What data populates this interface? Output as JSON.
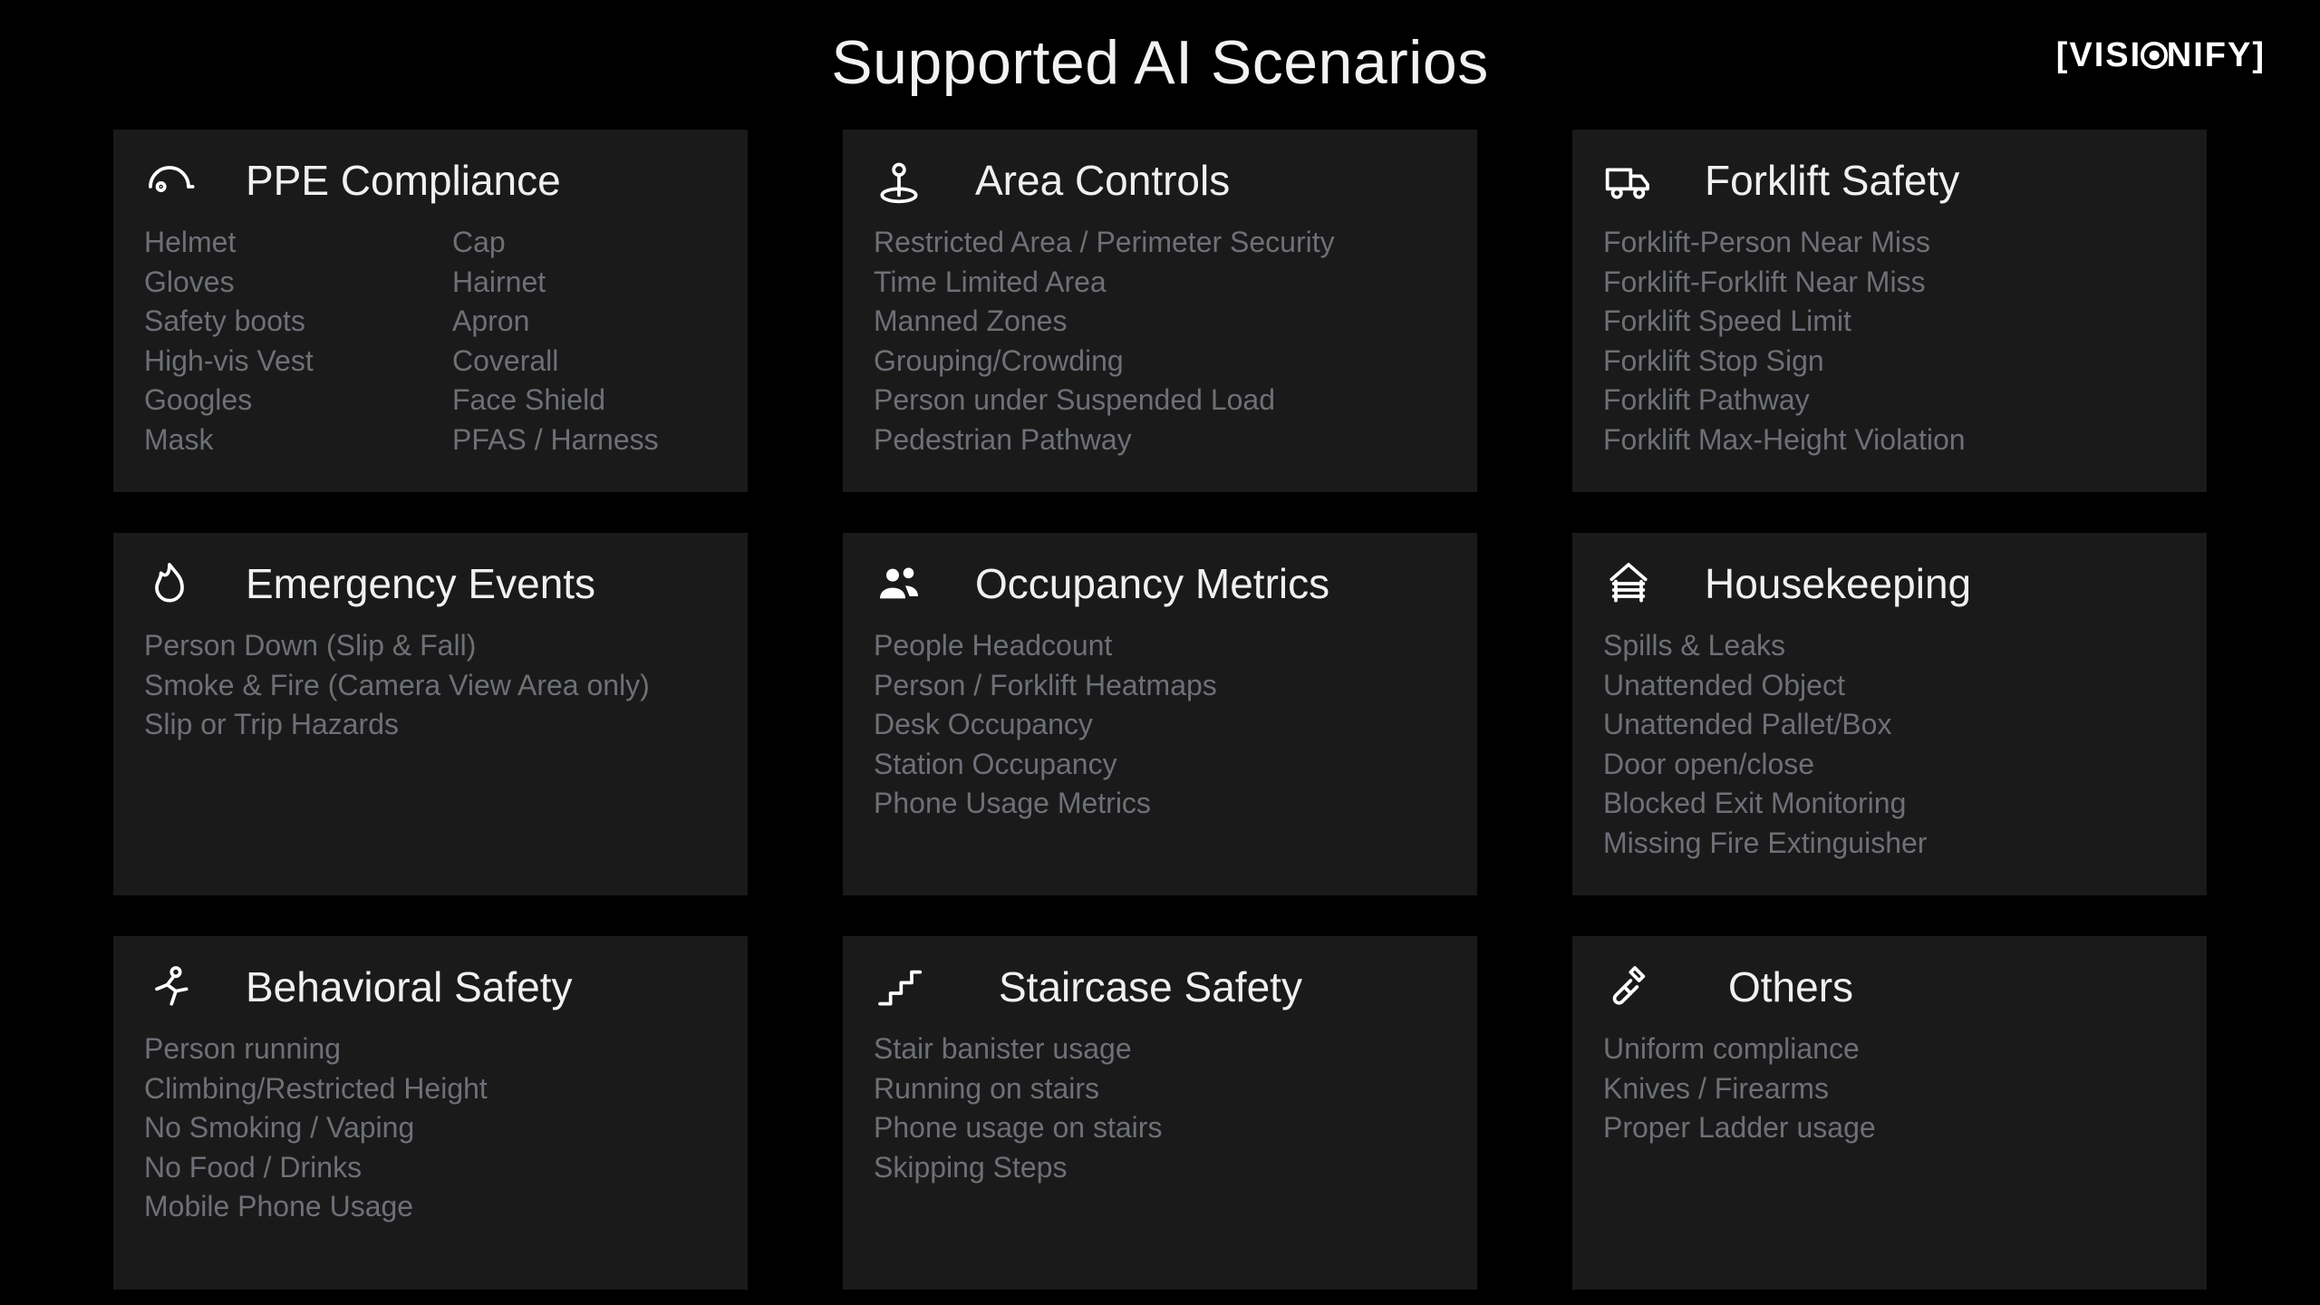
{
  "title": "Supported AI Scenarios",
  "brand": "VISIONIFY",
  "cards": [
    {
      "title": "PPE Compliance",
      "icon": "helmet",
      "two_col": true,
      "col1": [
        "Helmet",
        "Gloves",
        "Safety boots",
        "High-vis Vest",
        "Googles",
        "Mask"
      ],
      "col2": [
        "Cap",
        "Hairnet",
        "Apron",
        "Coverall",
        "Face Shield",
        "PFAS / Harness"
      ]
    },
    {
      "title": "Area Controls",
      "icon": "pin",
      "items": [
        "Restricted Area / Perimeter Security",
        "Time Limited Area",
        "Manned Zones",
        "Grouping/Crowding",
        "Person under Suspended Load",
        "Pedestrian Pathway"
      ]
    },
    {
      "title": "Forklift Safety",
      "icon": "truck",
      "items": [
        "Forklift-Person Near Miss",
        "Forklift-Forklift Near Miss",
        "Forklift Speed Limit",
        "Forklift Stop Sign",
        "Forklift Pathway",
        "Forklift Max-Height Violation"
      ]
    },
    {
      "title": "Emergency Events",
      "icon": "flame",
      "items": [
        "Person Down (Slip & Fall)",
        "Smoke & Fire (Camera View Area only)",
        "Slip or Trip Hazards"
      ]
    },
    {
      "title": "Occupancy Metrics",
      "icon": "people",
      "items": [
        "People Headcount",
        "Person / Forklift Heatmaps",
        "Desk Occupancy",
        "Station Occupancy",
        "Phone Usage Metrics"
      ]
    },
    {
      "title": "Housekeeping",
      "icon": "house",
      "items": [
        "Spills & Leaks",
        "Unattended Object",
        "Unattended Pallet/Box",
        "Door open/close",
        "Blocked Exit Monitoring",
        "Missing Fire Extinguisher"
      ]
    },
    {
      "title": "Behavioral Safety",
      "icon": "running",
      "items": [
        "Person running",
        "Climbing/Restricted Height",
        "No Smoking / Vaping",
        "No Food / Drinks",
        "Mobile Phone Usage"
      ]
    },
    {
      "title": "Staircase Safety",
      "icon": "stairs",
      "items": [
        "Stair banister usage",
        "Running on stairs",
        "Phone usage on stairs",
        "Skipping Steps"
      ]
    },
    {
      "title": "Others",
      "icon": "wrench",
      "items": [
        "Uniform compliance",
        "Knives / Firearms",
        "Proper Ladder usage"
      ]
    }
  ]
}
